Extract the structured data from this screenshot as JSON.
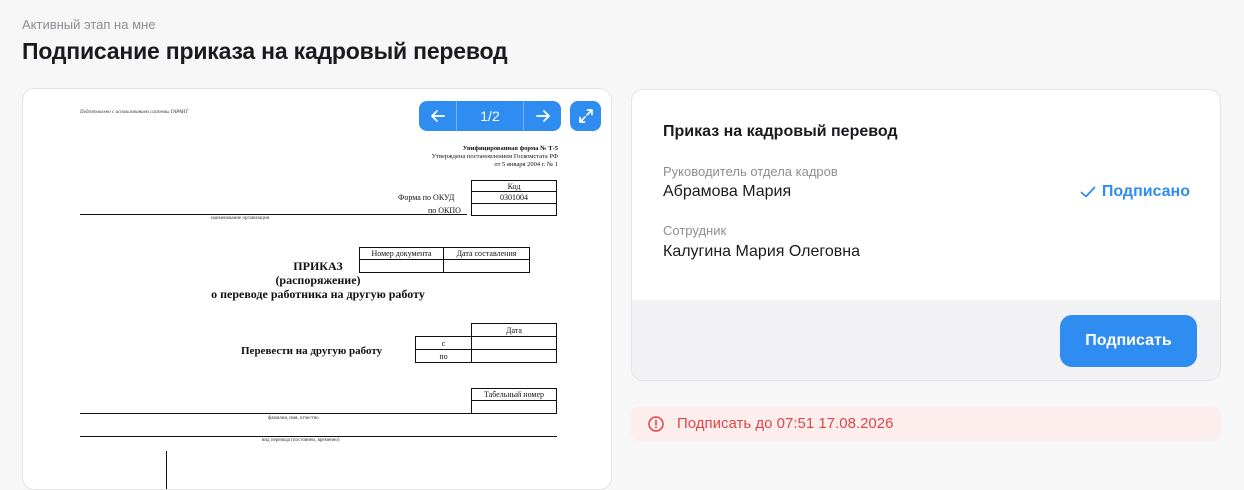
{
  "header": {
    "stage_label": "Активный этап на мне",
    "title": "Подписание приказа на кадровый перевод"
  },
  "viewer": {
    "page_indicator": "1/2",
    "prev_icon": "arrow-left-icon",
    "next_icon": "arrow-right-icon",
    "expand_icon": "expand-icon",
    "document": {
      "garant_note": "Подготовлено с использованием системы ГАРАНТ",
      "form_line1": "Унифицированная форма № Т-5",
      "form_line2": "Утверждена постановлением Госкомстата РФ",
      "form_line3": "от 5 января 2004 г. № 1",
      "code_header": "Код",
      "okud_label": "Форма по ОКУД",
      "okud_value": "0301004",
      "okpo_label": "по ОКПО",
      "org_caption": "наименование организации",
      "doc_number_header": "Номер документа",
      "doc_date_header": "Дата составления",
      "order_title": "ПРИКАЗ",
      "order_subtitle": "(распоряжение)",
      "order_desc": "о переводе работника на другую работу",
      "date_header": "Дата",
      "from_label": "с",
      "to_label": "по",
      "transfer_label": "Перевести на другую работу",
      "tab_number_header": "Табельный номер",
      "fio_caption": "фамилия, имя, отчество",
      "transfer_type_caption": "вид перевода (постоянно, временно)"
    }
  },
  "card": {
    "title": "Приказ на кадровый перевод",
    "signers": [
      {
        "role": "Руководитель отдела кадров",
        "name": "Абрамова Мария",
        "status": "Подписано"
      },
      {
        "role": "Сотрудник",
        "name": "Калугина Мария Олеговна"
      }
    ],
    "sign_button": "Подписать",
    "accent_color": "#2f8cf0"
  },
  "deadline": {
    "text": "Подписать до 07:51 17.08.2026",
    "icon": "alert-circle-icon",
    "color": "#e0464b"
  }
}
